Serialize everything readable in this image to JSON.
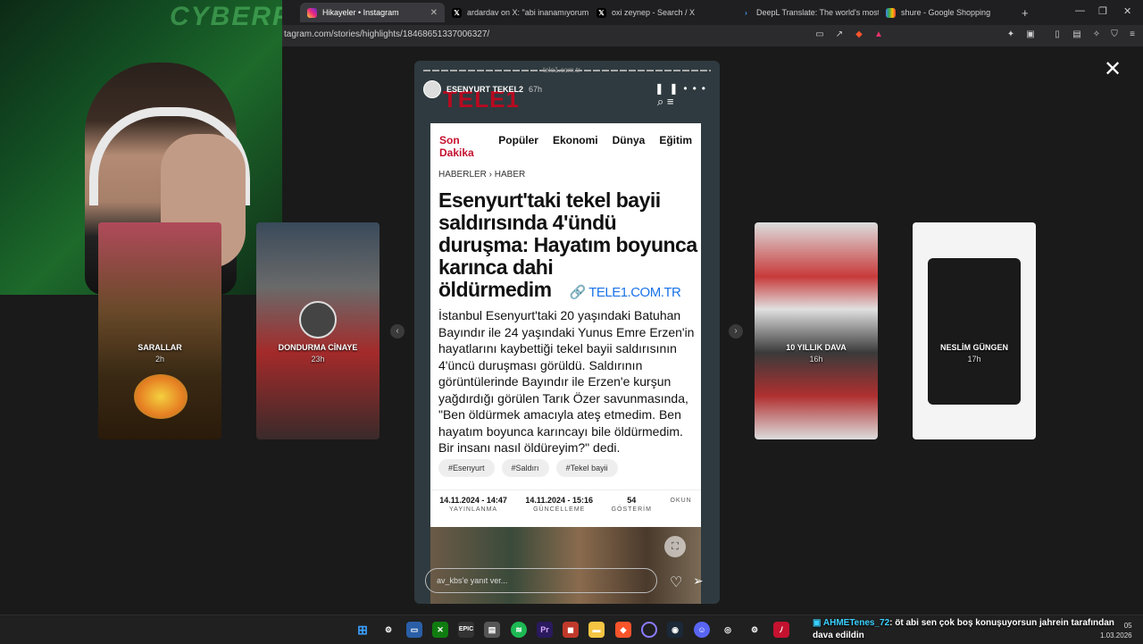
{
  "browser": {
    "tabs": [
      {
        "label": "Hikayeler • Instagram",
        "active": true,
        "icon": "instagram-icon"
      },
      {
        "label": "ardardav on X: \"abi inanamıyorum a",
        "active": false,
        "icon": "x-icon"
      },
      {
        "label": "oxi zeynep - Search / X",
        "active": false,
        "icon": "x-icon"
      },
      {
        "label": "DeepL Translate: The world's most a",
        "active": false,
        "icon": "deepl-icon"
      },
      {
        "label": "shure - Google Shopping",
        "active": false,
        "icon": "google-shopping-icon"
      }
    ],
    "new_tab_label": "+",
    "url": "tagram.com/stories/highlights/18468651337006327/"
  },
  "webcam": {
    "bg_text": "CYBERP"
  },
  "stories_left": [
    {
      "title": "SARALLAR",
      "time": "2h"
    },
    {
      "title": "DONDURMA CİNAYE",
      "time": "23h"
    }
  ],
  "stories_right": [
    {
      "title": "10 YILLIK DAVA",
      "time": "16h"
    },
    {
      "title": "NESLİM GÜNGEN",
      "time": "17h"
    }
  ],
  "main_story": {
    "username": "ESENYURT TEKEL2",
    "time": "67h",
    "watermark_logo": "TELE1",
    "watermark_url": "tele1.com.tr",
    "reply_placeholder": "av_kbs'e yanıt ver...",
    "article": {
      "menu": [
        "Son Dakika",
        "Popüler",
        "Ekonomi",
        "Dünya",
        "Eğitim"
      ],
      "breadcrumb": "HABERLER › HABER",
      "headline": "Esenyurt'taki tekel bayii saldırısında 4'ündü duruşma: Hayatım boyunca karınca dahi öldürmedim",
      "headline_link": "TELE1.COM.TR",
      "body": "İstanbul Esenyurt'taki 20 yaşındaki Batuhan Bayındır ile 24 yaşındaki Yunus Emre Erzen'in hayatlarını kaybettiği tekel bayii saldırısının 4'üncü duruşması görüldü. Saldırının görüntülerinde Bayındır ile Erzen'e kurşun yağdırdığı görülen Tarık Özer savunmasında, \"Ben öldürmek amacıyla ateş etmedim. Ben hayatım boyunca karıncayı bile öldürmedim. Bir insanı nasıl öldüreyim?\" dedi.",
      "tags": [
        "#Esenyurt",
        "#Saldırı",
        "#Tekel bayii"
      ],
      "meta": [
        {
          "value": "14.11.2024 - 14:47",
          "label": "YAYINLANMA"
        },
        {
          "value": "14.11.2024 - 15:16",
          "label": "GÜNCELLEME"
        },
        {
          "value": "54",
          "label": "GÖSTERİM"
        },
        {
          "value": "",
          "label": "OKUN"
        }
      ]
    }
  },
  "chat": {
    "user": "AHMETenes_72",
    "message": ": öt abi sen çok boş konuşuyorsun jahrein tarafından dava edildin"
  },
  "clock": {
    "time": "05",
    "date": "1.03.2026"
  }
}
